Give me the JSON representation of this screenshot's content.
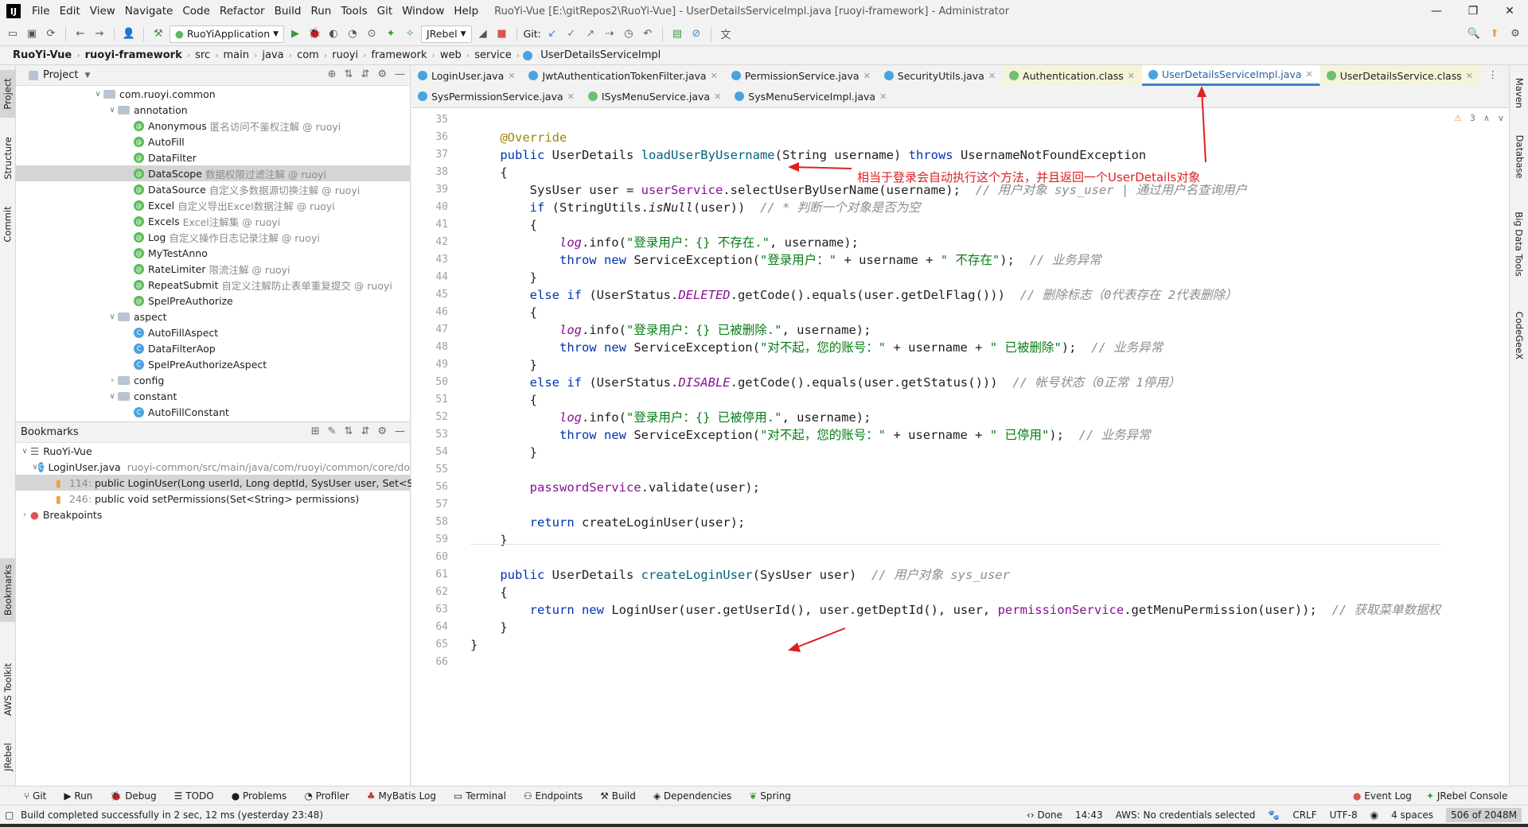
{
  "window": {
    "logo": "IJ",
    "menu": [
      "File",
      "Edit",
      "View",
      "Navigate",
      "Code",
      "Refactor",
      "Build",
      "Run",
      "Tools",
      "Git",
      "Window",
      "Help"
    ],
    "title": "RuoYi-Vue [E:\\gitRepos2\\RuoYi-Vue] - UserDetailsServiceImpl.java [ruoyi-framework] - Administrator"
  },
  "toolbar": {
    "run_config": "RuoYiApplication",
    "jrebel": "JRebel",
    "git_label": "Git:"
  },
  "breadcrumb": [
    "RuoYi-Vue",
    "ruoyi-framework",
    "src",
    "main",
    "java",
    "com",
    "ruoyi",
    "framework",
    "web",
    "service",
    "UserDetailsServiceImpl"
  ],
  "left_strip": [
    "Project",
    "Structure",
    "Commit",
    "Bookmarks",
    "AWS Toolkit",
    "JRebel"
  ],
  "right_strip": [
    "Maven",
    "Database",
    "Big Data Tools",
    "CodeGeeX"
  ],
  "project": {
    "title": "Project",
    "items": [
      {
        "label": "com.ruoyi.common",
        "note": ""
      },
      {
        "label": "annotation",
        "note": ""
      },
      {
        "label": "Anonymous",
        "note": "匿名访问不鉴权注解 @ ruoyi"
      },
      {
        "label": "AutoFill",
        "note": ""
      },
      {
        "label": "DataFilter",
        "note": ""
      },
      {
        "label": "DataScope",
        "note": "数据权限过滤注解 @ ruoyi"
      },
      {
        "label": "DataSource",
        "note": "自定义多数据源切换注解 @ ruoyi"
      },
      {
        "label": "Excel",
        "note": "自定义导出Excel数据注解 @ ruoyi"
      },
      {
        "label": "Excels",
        "note": "Excel注解集 @ ruoyi"
      },
      {
        "label": "Log",
        "note": "自定义操作日志记录注解 @ ruoyi"
      },
      {
        "label": "MyTestAnno",
        "note": ""
      },
      {
        "label": "RateLimiter",
        "note": "限流注解 @ ruoyi"
      },
      {
        "label": "RepeatSubmit",
        "note": "自定义注解防止表单重复提交 @ ruoyi"
      },
      {
        "label": "SpelPreAuthorize",
        "note": ""
      },
      {
        "label": "aspect",
        "note": ""
      },
      {
        "label": "AutoFillAspect",
        "note": ""
      },
      {
        "label": "DataFilterAop",
        "note": ""
      },
      {
        "label": "SpelPreAuthorizeAspect",
        "note": ""
      },
      {
        "label": "config",
        "note": ""
      },
      {
        "label": "constant",
        "note": ""
      },
      {
        "label": "AutoFillConstant",
        "note": ""
      }
    ]
  },
  "bookmarks": {
    "title": "Bookmarks",
    "root": "RuoYi-Vue",
    "file": "LoginUser.java",
    "file_path": "ruoyi-common/src/main/java/com/ruoyi/common/core/do",
    "entries": [
      {
        "line": "114:",
        "text": "public LoginUser(Long userId, Long deptId, SysUser user, Set<Stri"
      },
      {
        "line": "246:",
        "text": "public void setPermissions(Set<String> permissions)"
      }
    ],
    "breakpoints": "Breakpoints"
  },
  "tabs": {
    "row1": [
      "LoginUser.java",
      "JwtAuthenticationTokenFilter.java",
      "PermissionService.java",
      "SecurityUtils.java",
      "Authentication.class",
      "UserDetailsServiceImpl.java",
      "UserDetailsService.class"
    ],
    "row2": [
      "SysPermissionService.java",
      "ISysMenuService.java",
      "SysMenuServiceImpl.java"
    ]
  },
  "editor": {
    "warnings": "3",
    "line_numbers": [
      "35",
      "36",
      "37",
      "38",
      "39",
      "40",
      "41",
      "42",
      "43",
      "44",
      "45",
      "46",
      "47",
      "48",
      "49",
      "50",
      "51",
      "52",
      "53",
      "54",
      "55",
      "56",
      "57",
      "58",
      "59",
      "60",
      "61",
      "62",
      "63",
      "64",
      "65",
      "66"
    ],
    "annotation": "相当于登录会自动执行这个方法，并且返回一个UserDetails对象"
  },
  "bottom_tools": [
    "Git",
    "Run",
    "Debug",
    "TODO",
    "Problems",
    "Profiler",
    "MyBatis Log",
    "Terminal",
    "Endpoints",
    "Build",
    "Dependencies",
    "Spring"
  ],
  "bottom_tools_right": [
    "Event Log",
    "JRebel Console"
  ],
  "status": {
    "message": "Build completed successfully in 2 sec, 12 ms (yesterday 23:48)",
    "done": "Done",
    "time": "14:43",
    "aws": "AWS: No credentials selected",
    "line_sep": "CRLF",
    "encoding": "UTF-8",
    "indent": "4 spaces",
    "memory": "506 of 2048M"
  },
  "colors": {
    "accent": "#4083c9",
    "keyword": "#0033b3",
    "string": "#067d17",
    "comment": "#8c8c8c",
    "annotation": "#e02020"
  }
}
